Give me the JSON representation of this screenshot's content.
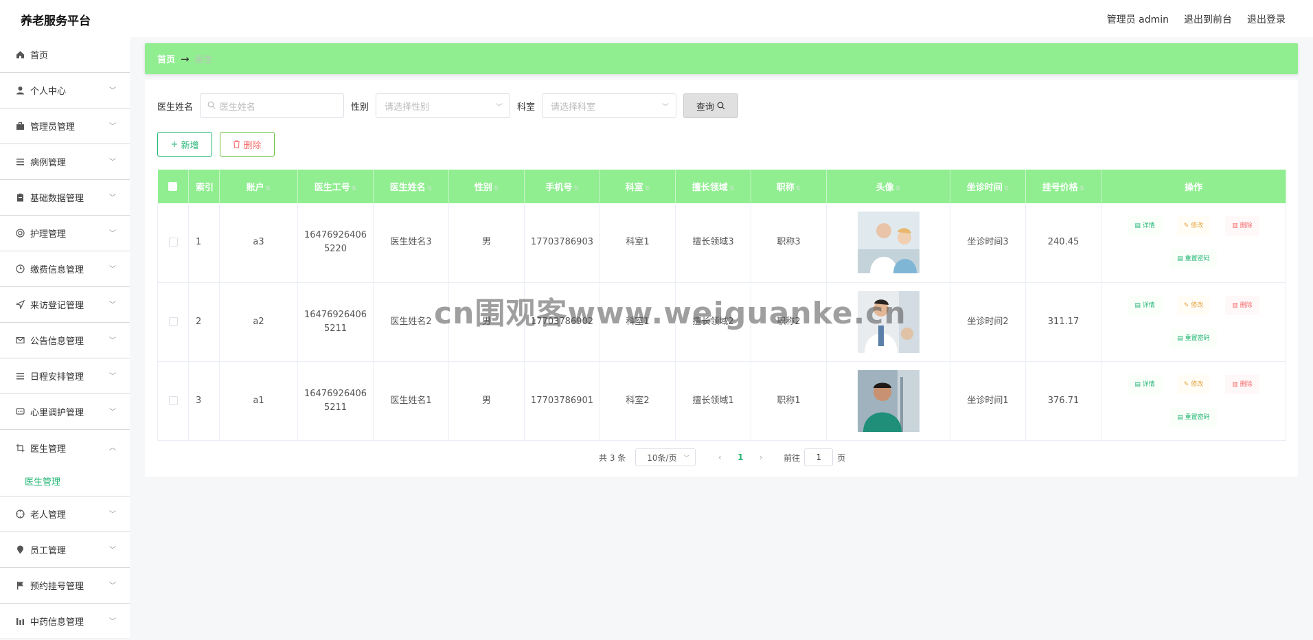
{
  "app": {
    "title": "养老服务平台"
  },
  "top_links": {
    "admin": "管理员 admin",
    "front": "退出到前台",
    "logout": "退出登录"
  },
  "sidebar": {
    "items": [
      {
        "label": "首页",
        "icon": "home-icon",
        "expandable": false
      },
      {
        "label": "个人中心",
        "icon": "user-icon",
        "expandable": true
      },
      {
        "label": "管理员管理",
        "icon": "briefcase-icon",
        "expandable": true
      },
      {
        "label": "病例管理",
        "icon": "list-icon",
        "expandable": true
      },
      {
        "label": "基础数据管理",
        "icon": "clipboard-icon",
        "expandable": true
      },
      {
        "label": "护理管理",
        "icon": "target-icon",
        "expandable": true
      },
      {
        "label": "缴费信息管理",
        "icon": "clock-icon",
        "expandable": true
      },
      {
        "label": "来访登记管理",
        "icon": "send-icon",
        "expandable": true
      },
      {
        "label": "公告信息管理",
        "icon": "mail-icon",
        "expandable": true
      },
      {
        "label": "日程安排管理",
        "icon": "list-icon",
        "expandable": true
      },
      {
        "label": "心里调护管理",
        "icon": "chat-icon",
        "expandable": true
      },
      {
        "label": "医生管理",
        "icon": "crop-icon",
        "expandable": true,
        "open": true,
        "sub": "医生管理"
      },
      {
        "label": "老人管理",
        "icon": "crosshair-icon",
        "expandable": true
      },
      {
        "label": "员工管理",
        "icon": "location-icon",
        "expandable": true
      },
      {
        "label": "预约挂号管理",
        "icon": "flag-icon",
        "expandable": true
      },
      {
        "label": "中药信息管理",
        "icon": "bar-chart-icon",
        "expandable": true
      }
    ]
  },
  "breadcrumb": {
    "home": "首页",
    "separator": "→",
    "current": "医生"
  },
  "search": {
    "name_label": "医生姓名",
    "name_placeholder": "医生姓名",
    "gender_label": "性别",
    "gender_placeholder": "请选择性别",
    "dept_label": "科室",
    "dept_placeholder": "请选择科室",
    "query_label": "查询"
  },
  "actions": {
    "add_label": "新增",
    "delete_label": "删除"
  },
  "table": {
    "columns": [
      "索引",
      "账户",
      "医生工号",
      "医生姓名",
      "性别",
      "手机号",
      "科室",
      "擅长领域",
      "职称",
      "头像",
      "坐诊时间",
      "挂号价格",
      "操作"
    ],
    "op_labels": {
      "detail": "详情",
      "edit": "修改",
      "remove": "删除",
      "reset": "重置密码"
    },
    "rows": [
      {
        "index": "1",
        "account": "a3",
        "no": "164769264065220",
        "name": "医生姓名3",
        "gender": "男",
        "phone": "17703786903",
        "dept": "科室1",
        "field": "擅长领域3",
        "title": "职称3",
        "time": "坐诊时间3",
        "price": "240.45"
      },
      {
        "index": "2",
        "account": "a2",
        "no": "164769264065211",
        "name": "医生姓名2",
        "gender": "男",
        "phone": "17703786902",
        "dept": "科室1",
        "field": "擅长领域2",
        "title": "职称2",
        "time": "坐诊时间2",
        "price": "311.17"
      },
      {
        "index": "3",
        "account": "a1",
        "no": "164769264065211",
        "name": "医生姓名1",
        "gender": "男",
        "phone": "17703786901",
        "dept": "科室2",
        "field": "擅长领域1",
        "title": "职称1",
        "time": "坐诊时间1",
        "price": "376.71"
      }
    ]
  },
  "pager": {
    "total": "共 3 条",
    "page_size": "10条/页",
    "prev": "‹",
    "current": "1",
    "next": "›",
    "goto": "前往",
    "goto_value": "1",
    "page_unit": "页"
  },
  "watermark": "cn围观客www.weiguanke.cn",
  "colors": {
    "accent": "#90ee90",
    "green_text": "#22b573",
    "danger": "#f56c6c",
    "warning": "#e6a23c"
  }
}
